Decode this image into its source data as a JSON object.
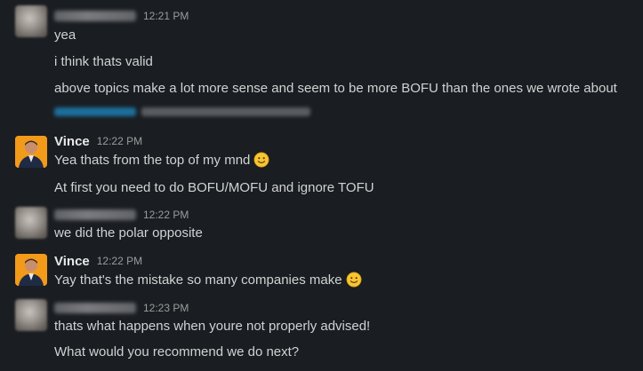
{
  "messages": [
    {
      "author": "",
      "time": "12:21 PM",
      "lines": [
        "yea",
        "i think thats valid",
        "above topics make a lot more sense and seem to be more BOFU than the ones we wrote about"
      ]
    },
    {
      "author": "Vince",
      "time": "12:22 PM",
      "lines": [
        "Yea thats from the top of my mnd",
        "At first you need to do BOFU/MOFU and ignore TOFU"
      ]
    },
    {
      "author": "",
      "time": "12:22 PM",
      "lines": [
        "we did the polar opposite"
      ]
    },
    {
      "author": "Vince",
      "time": "12:22 PM",
      "lines": [
        "Yay that's the mistake so many companies make"
      ]
    },
    {
      "author": "",
      "time": "12:23 PM",
      "lines": [
        "thats what happens when youre not properly advised!",
        "What would you recommend we do next?"
      ]
    }
  ],
  "icons": {
    "emoji": "slightly-smiling-face-icon"
  },
  "colors": {
    "background": "#1a1d21",
    "text": "#d1d2d3",
    "link": "#1d9bd1",
    "vince_avatar_bg": "#f29a1a"
  }
}
